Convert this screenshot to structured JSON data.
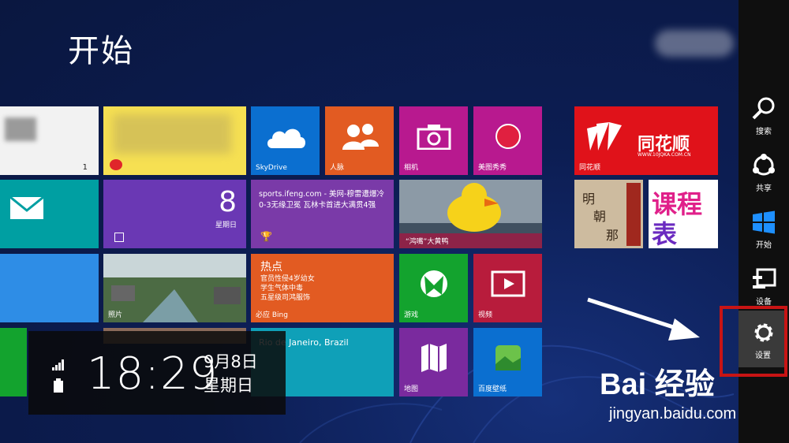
{
  "start": {
    "title": "开始"
  },
  "tiles": {
    "people_blur_count": "1",
    "skydrive": "SkyDrive",
    "people": "人脉",
    "camera": "相机",
    "meitu": "美图秀秀",
    "tonghuashun": "同花顺",
    "tonghuashun_logo": "同花顺",
    "tonghuashun_url": "WWW.10JQKA.COM.CN",
    "calendar_day": "8",
    "calendar_weekday": "星期日",
    "news_text": "sports.ifeng.com - 美网-穆雷遭爆冷 0-3无缘卫冕 瓦林卡首进大满贯4强",
    "duck": "“鸿嘴”大黄鸭",
    "photos": "照片",
    "hot_title": "热点",
    "hot_items": [
      "官员性侵4岁幼女",
      "学生气体中毒",
      "五星级司鸿服饰"
    ],
    "bing": "必应 Bing",
    "games": "游戏",
    "video": "视频",
    "weather": "Rio de Janeiro, Brazil",
    "maps": "地图",
    "wallpaper": "百度壁纸"
  },
  "charms": {
    "search": "搜索",
    "share": "共享",
    "start": "开始",
    "devices": "设备",
    "settings": "设置"
  },
  "clock": {
    "time": "18:29",
    "date": "9月8日",
    "weekday": "星期日"
  },
  "watermark": {
    "brand": "Bai 经验",
    "url": "jingyan.baidu.com"
  },
  "colors": {
    "highlight": "#c81414",
    "accent": "#0b1a4a"
  }
}
